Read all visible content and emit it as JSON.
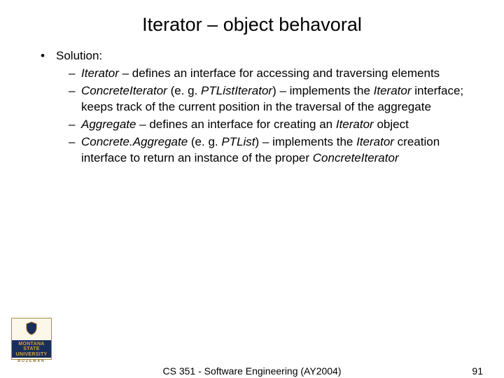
{
  "title": "Iterator – object behavoral",
  "solution_label": "Solution:",
  "items": [
    {
      "term": "Iterator",
      "rest": " – defines an interface for accessing and traversing elements"
    },
    {
      "term": "ConcreteIterator",
      "mid1": " (e. g. ",
      "ex": "PTListIterator",
      "mid2": ") – implements the ",
      "term2": "Iterator",
      "rest": " interface; keeps track of the current position in the traversal of the aggregate"
    },
    {
      "term": "Aggregate",
      "mid": " – defines an interface for creating an ",
      "term2": "Iterator",
      "rest": " object"
    },
    {
      "term": "Concrete.Aggregate",
      "mid1": " (e. g. ",
      "ex": "PTList",
      "mid2": ") – implements the ",
      "term2": "Iterator",
      "mid3": " creation interface to return an instance of the proper ",
      "term3": "ConcreteIterator"
    }
  ],
  "footer": {
    "center": "CS 351 - Software Engineering (AY2004)",
    "page": "91"
  },
  "logo": {
    "line1": "MONTANA",
    "line2": "STATE UNIVERSITY",
    "bozeman": "BOZEMAN"
  }
}
